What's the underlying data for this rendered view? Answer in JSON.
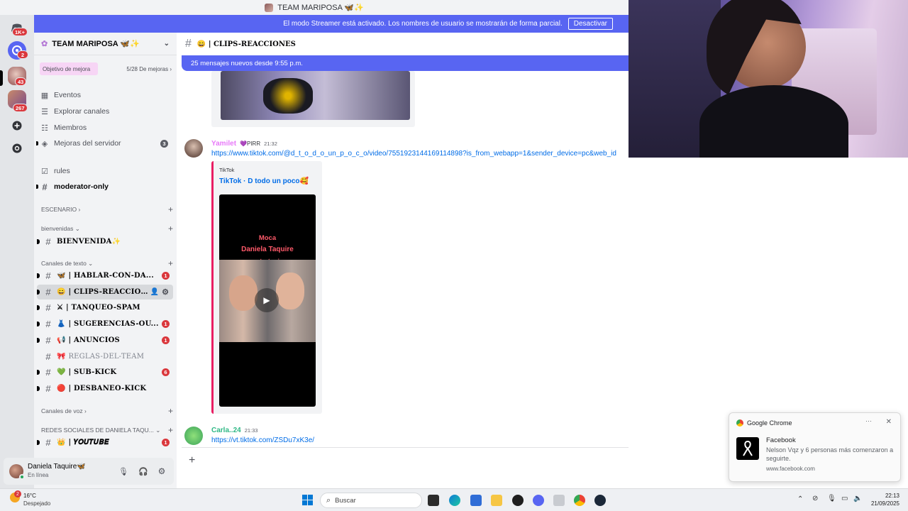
{
  "window": {
    "title": "TEAM MARIPOSA 🦋✨"
  },
  "rail": {
    "badges": [
      "1K+",
      "2",
      "43",
      "267"
    ]
  },
  "streamer": {
    "text": "El modo Streamer está activado. Los nombres de usuario se mostrarán de forma parcial.",
    "button": "Desactivar"
  },
  "server": {
    "name": "TEAM MARIPOSA 🦋✨",
    "boost_label": "Objetivo de mejora",
    "boost_progress": "5/28 De mejoras",
    "boost_fraction": 0.18
  },
  "nav": [
    {
      "label": "Eventos"
    },
    {
      "label": "Explorar canales"
    },
    {
      "label": "Miembros"
    },
    {
      "label": "Mejoras del servidor",
      "badge": "3"
    },
    {
      "label": "rules"
    },
    {
      "label": "moderator-only"
    }
  ],
  "categories": {
    "escenario": "ESCENARIO",
    "bienvenidas": "bienvenidas",
    "texto": "Canales de texto",
    "voz": "Canales de voz",
    "redes": "REDES SOCIALES DE DANIELA TAQU..."
  },
  "channels": [
    {
      "emoji": "",
      "name": "BIENVENIDA✨",
      "badge": ""
    },
    {
      "emoji": "🦋",
      "name": "| HABLAR-CON-DA...",
      "badge": "1"
    },
    {
      "emoji": "😄",
      "name": "| CLIPS-REACCION...",
      "badge": ""
    },
    {
      "emoji": "⚔",
      "name": "| TANQUEO-SPAM",
      "badge": ""
    },
    {
      "emoji": "👗",
      "name": "| SUGERENCIAS-OU...",
      "badge": "1"
    },
    {
      "emoji": "📢",
      "name": "| ANUNCIOS",
      "badge": "1"
    },
    {
      "emoji": "🎀",
      "name": "REGLAS-DEL-TEAM",
      "badge": ""
    },
    {
      "emoji": "💚",
      "name": "| SUB-KICK",
      "badge": "6"
    },
    {
      "emoji": "🔴",
      "name": "| DESBANEO-KICK",
      "badge": ""
    },
    {
      "emoji": "👑",
      "name": "| 𝒀𝑶𝑼𝑻𝑼𝑩𝑬",
      "badge": "1"
    }
  ],
  "user": {
    "name": "Daniela Taquire🦋",
    "status": "En línea"
  },
  "chat": {
    "channel": "😄 | CLIPS-REACCIONES",
    "new_messages": "25 mensajes nuevos desde 9:55 p.m.",
    "messages": [
      {
        "author": "Yamilet",
        "role": "💜PIRR",
        "time": "21:32",
        "link": "https://www.tiktok.com/@d_t_o_d_o_un_p_o_c_o/video/7551923144169114898?is_from_webapp=1&sender_device=pc&web_id",
        "embed_provider": "TikTok",
        "embed_title": "TikTok · D todo un poco🥰",
        "video_text1": "Moca",
        "video_text2": "Daniela Taquire",
        "video_text3": "estrategia"
      },
      {
        "author": "Carla..24",
        "time": "21:33",
        "link": "https://vt.tiktok.com/ZSDu7xK3e/"
      }
    ]
  },
  "notification": {
    "app": "Google Chrome",
    "title": "Facebook",
    "body": "Nelson Vqz y 6 personas más comenzaron a seguirte.",
    "source": "www.facebook.com"
  },
  "taskbar": {
    "weather_temp": "16°C",
    "weather_desc": "Despejado",
    "weather_badge": "2",
    "search_placeholder": "Buscar",
    "time": "22:13",
    "date": "21/09/2025"
  },
  "colors": {
    "blurple": "#5865f2",
    "red_badge": "#da373c",
    "link": "#006ce7",
    "yamilet": "#e879f9",
    "carla": "#2fb885"
  }
}
